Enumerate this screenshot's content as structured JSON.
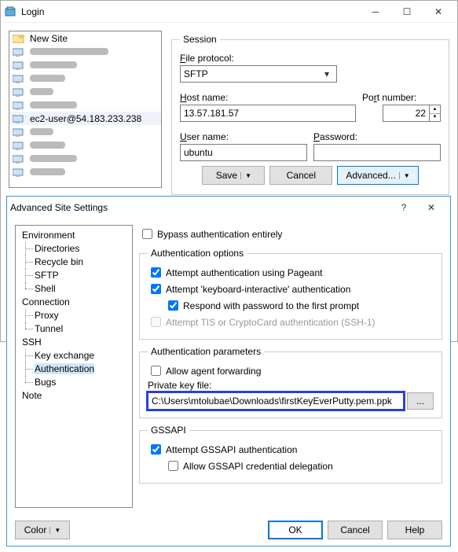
{
  "login": {
    "title": "Login",
    "sites": {
      "new_site": "New Site",
      "selected": "ec2-user@54.183.233.238"
    },
    "session": {
      "legend": "Session",
      "protocol_label": "File protocol:",
      "protocol_value": "SFTP",
      "host_label": "Host name:",
      "host_value": "13.57.181.57",
      "port_label": "Port number:",
      "port_value": "22",
      "user_label": "User name:",
      "user_value": "ubuntu",
      "pass_label": "Password:",
      "pass_value": ""
    },
    "buttons": {
      "save": "Save",
      "cancel": "Cancel",
      "advanced": "Advanced..."
    }
  },
  "advanced": {
    "title": "Advanced Site Settings",
    "tree": {
      "environment": "Environment",
      "directories": "Directories",
      "recycle": "Recycle bin",
      "sftp": "SFTP",
      "shell": "Shell",
      "connection": "Connection",
      "proxy": "Proxy",
      "tunnel": "Tunnel",
      "ssh": "SSH",
      "keyexchange": "Key exchange",
      "authentication": "Authentication",
      "bugs": "Bugs",
      "note": "Note"
    },
    "bypass": "Bypass authentication entirely",
    "auth_options": {
      "legend": "Authentication options",
      "pageant": "Attempt authentication using Pageant",
      "kbint": "Attempt 'keyboard-interactive' authentication",
      "respond": "Respond with password to the first prompt",
      "tis": "Attempt TIS or CryptoCard authentication (SSH-1)"
    },
    "auth_params": {
      "legend": "Authentication parameters",
      "agentfwd": "Allow agent forwarding",
      "pk_label": "Private key file:",
      "pk_value": "C:\\Users\\mtolubae\\Downloads\\firstKeyEverPutty.pem.ppk",
      "browse": "..."
    },
    "gssapi": {
      "legend": "GSSAPI",
      "attempt": "Attempt GSSAPI authentication",
      "deleg": "Allow GSSAPI credential delegation"
    },
    "buttons": {
      "color": "Color",
      "ok": "OK",
      "cancel": "Cancel",
      "help": "Help"
    }
  }
}
